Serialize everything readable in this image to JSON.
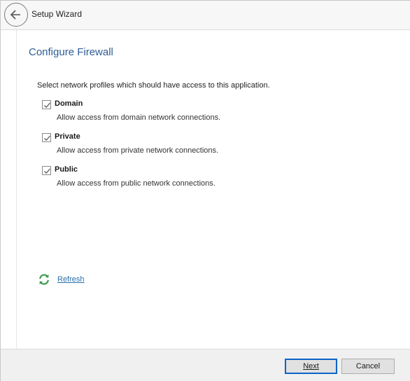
{
  "titlebar": {
    "title": "Setup Wizard"
  },
  "page": {
    "title": "Configure Firewall",
    "instruction": "Select network profiles which should have access to this application."
  },
  "profiles": [
    {
      "name": "Domain",
      "description": "Allow access from domain network connections.",
      "checked": true
    },
    {
      "name": "Private",
      "description": "Allow access from private network connections.",
      "checked": true
    },
    {
      "name": "Public",
      "description": "Allow access from public network connections.",
      "checked": true
    }
  ],
  "refresh": {
    "label": "Refresh",
    "icon": "refresh-icon"
  },
  "footer": {
    "next_label": "Next",
    "cancel_label": "Cancel"
  },
  "colors": {
    "title_blue": "#2e5c94",
    "link_blue": "#2a6fa8",
    "refresh_green": "#3a9a4a",
    "default_button_border": "#0a64c8"
  }
}
